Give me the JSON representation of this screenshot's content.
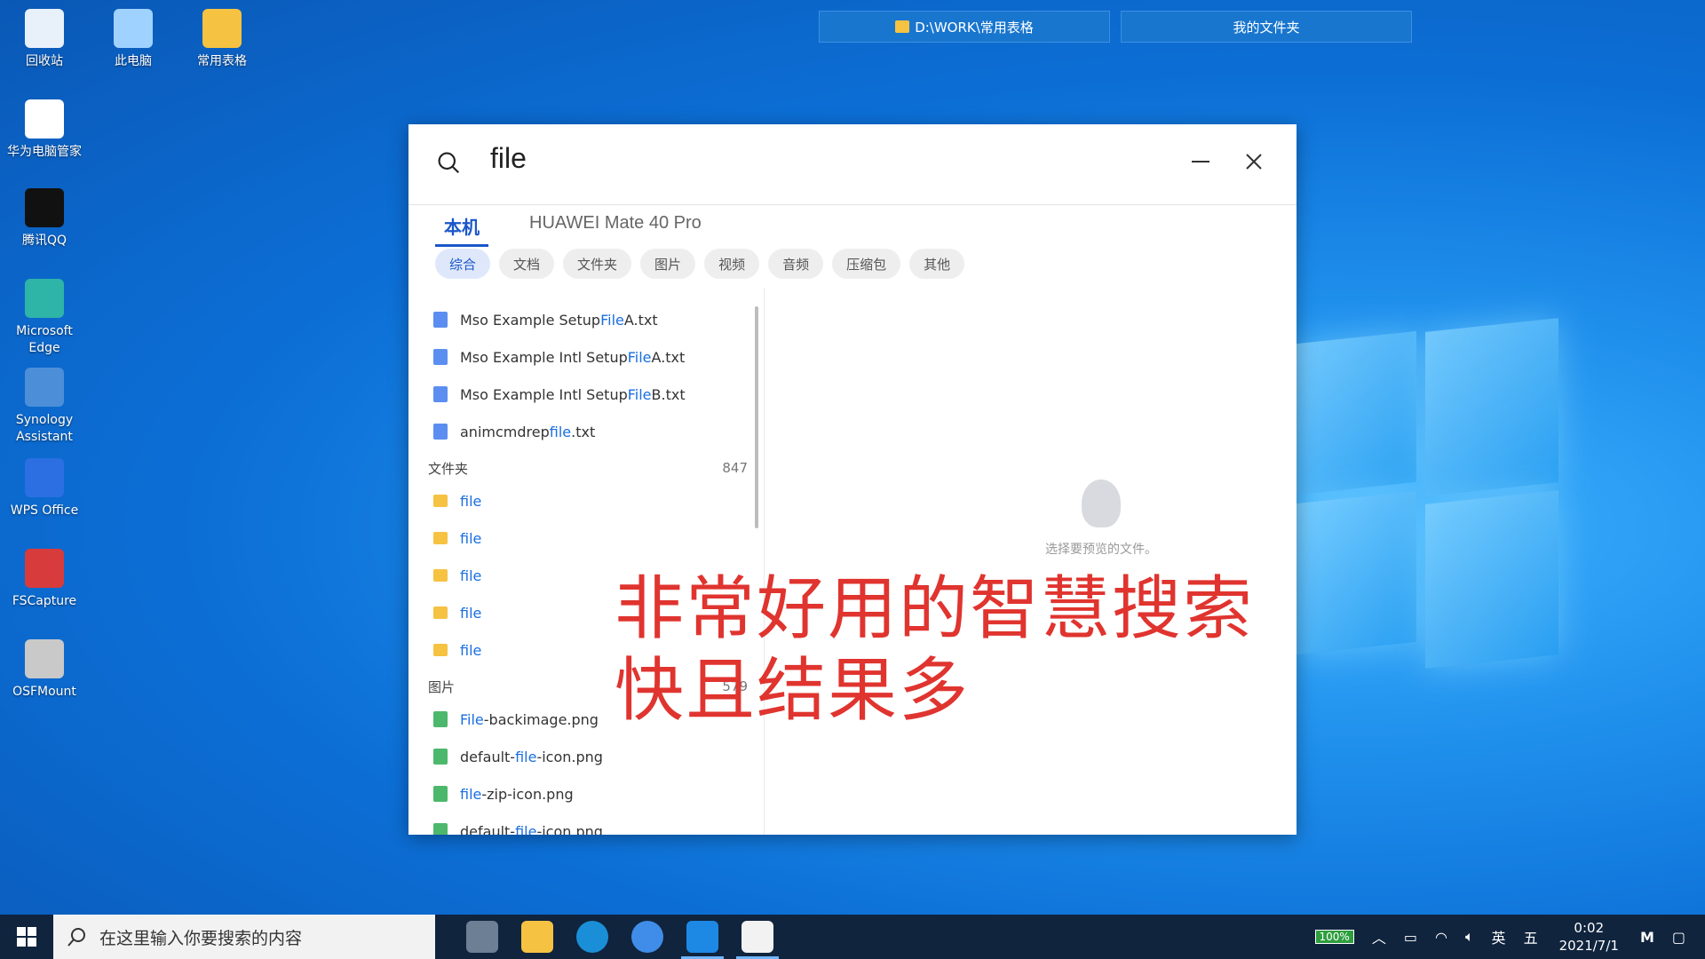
{
  "desktop": {
    "icons": [
      {
        "label": "回收站",
        "icon": "recycle-bin-icon",
        "color": "#e8f0fa"
      },
      {
        "label": "此电脑",
        "icon": "computer-icon",
        "color": "#9fd2ff"
      },
      {
        "label": "常用表格",
        "icon": "folder-icon",
        "color": "#f5c242"
      },
      {
        "label": "华为电脑管家",
        "icon": "huawei-pc-manager-icon",
        "color": "#ffffff"
      },
      {
        "label": "腾讯QQ",
        "icon": "qq-icon",
        "color": "#111111"
      },
      {
        "label": "Microsoft Edge",
        "icon": "edge-icon",
        "color": "#2fb4a8"
      },
      {
        "label": "Synology Assistant",
        "icon": "synology-icon",
        "color": "#4c8fd8"
      },
      {
        "label": "WPS Office",
        "icon": "wps-icon",
        "color": "#2b6fe3"
      },
      {
        "label": "FSCapture",
        "icon": "fscapture-icon",
        "color": "#d83b3b"
      },
      {
        "label": "OSFMount",
        "icon": "osfmount-icon",
        "color": "#c9c9c9"
      }
    ],
    "top_windows": [
      "D:\\WORK\\常用表格",
      "我的文件夹"
    ]
  },
  "search_window": {
    "query": "file",
    "tabs": [
      {
        "label": "本机",
        "active": true
      },
      {
        "label": "HUAWEI Mate 40 Pro",
        "active": false
      }
    ],
    "chips": [
      {
        "label": "综合",
        "active": true
      },
      {
        "label": "文档",
        "active": false
      },
      {
        "label": "文件夹",
        "active": false
      },
      {
        "label": "图片",
        "active": false
      },
      {
        "label": "视频",
        "active": false
      },
      {
        "label": "音频",
        "active": false
      },
      {
        "label": "压缩包",
        "active": false
      },
      {
        "label": "其他",
        "active": false
      }
    ],
    "documents": [
      {
        "pre": "Mso Example Setup ",
        "hl": "File",
        "post": " A.txt"
      },
      {
        "pre": "Mso Example Intl Setup ",
        "hl": "File",
        "post": " A.txt"
      },
      {
        "pre": "Mso Example Intl Setup ",
        "hl": "File",
        "post": " B.txt"
      },
      {
        "pre": "animcmdrep",
        "hl": "file",
        "post": ".txt"
      }
    ],
    "folder_section": {
      "title": "文件夹",
      "count": "847"
    },
    "folders": [
      "file",
      "file",
      "file",
      "file",
      "file"
    ],
    "image_section": {
      "title": "图片",
      "count": "579"
    },
    "images": [
      {
        "pre": "",
        "hl": "File",
        "post": "-backimage.png"
      },
      {
        "pre": "default-",
        "hl": "file",
        "post": "-icon.png"
      },
      {
        "pre": "",
        "hl": "file",
        "post": "-zip-icon.png"
      },
      {
        "pre": "default-",
        "hl": "file",
        "post": "-icon.png"
      }
    ],
    "preview_hint": "选择要预览的文件。"
  },
  "overlay_caption": {
    "line1": "非常好用的智慧搜索",
    "line2": "快且结果多"
  },
  "taskbar": {
    "search_placeholder": "在这里输入你要搜索的内容",
    "battery": "100%",
    "ime_lang": "英",
    "ime_mode": "五",
    "time": "0:02",
    "date": "2021/7/1"
  }
}
